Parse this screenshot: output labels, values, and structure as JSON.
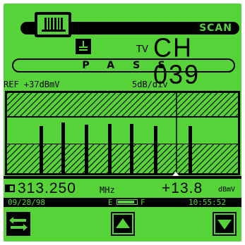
{
  "header": {
    "scan_label": "SCAN",
    "tv_label": "TV",
    "channel_label": "CH 039"
  },
  "status": {
    "pass_text": "PASS"
  },
  "scale": {
    "reference": "REF +37dBmV",
    "division": "5dB/div"
  },
  "readout": {
    "frequency": "313.250",
    "frequency_unit": "MHz",
    "level": "+13.8",
    "level_unit": "dBmV"
  },
  "status_bar": {
    "date": "09/28/98",
    "battery_empty_label": "E",
    "battery_full_label": "F",
    "battery_level": 0.9,
    "time": "10:55:52"
  },
  "icons": {
    "swap": "swap-arrows-icon",
    "up": "up-arrow-icon",
    "down": "down-arrow-icon",
    "antenna": "antenna-icon"
  },
  "colors": {
    "screen": "#57d33a",
    "ink": "#000000"
  }
}
